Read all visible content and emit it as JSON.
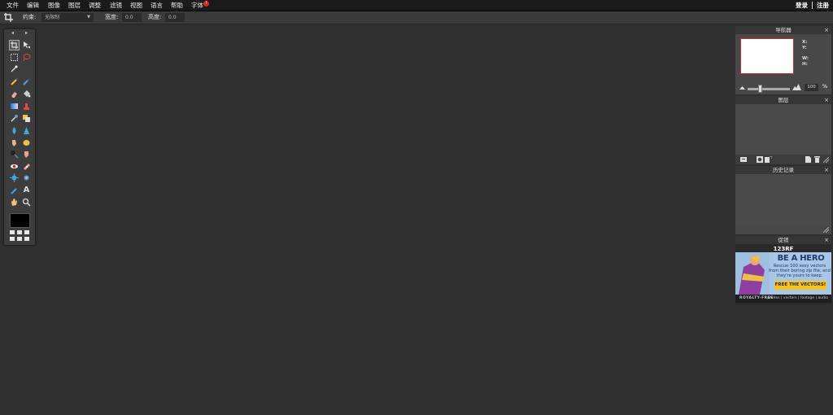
{
  "menu": [
    "文件",
    "编辑",
    "图像",
    "图层",
    "调整",
    "滤镜",
    "视图",
    "语言",
    "帮助",
    "字体"
  ],
  "font_badge": "!",
  "account": {
    "login": "登录",
    "register": "注册"
  },
  "options": {
    "constraint_label": "约束:",
    "constraint_value": "无限制",
    "width_label": "宽度:",
    "width_value": "0.0",
    "height_label": "高度:",
    "height_value": "0.0"
  },
  "toolbox": {
    "prev_arrow": "◂",
    "next_arrow": "▸",
    "text_tool": "A"
  },
  "colors": {
    "foreground": "#000000",
    "accent_red": "#e02424",
    "nav_border": "#c43030",
    "cta": "#f5c518"
  },
  "panels": {
    "navigator": {
      "title": "导航器",
      "close": "×",
      "x_label": "X:",
      "y_label": "Y:",
      "w_label": "W:",
      "h_label": "H:",
      "zoom_value": "100",
      "zoom_unit": "%"
    },
    "layers": {
      "title": "图层",
      "close": "×"
    },
    "history": {
      "title": "历史记录",
      "close": "×"
    },
    "promo": {
      "title": "促销",
      "close": "×"
    }
  },
  "ad": {
    "logo": "123RF",
    "headline": "BE A HERO",
    "body": "Rescue 100 sexy vectors from their boring zip file, and they're yours to keep.",
    "cta": "FREE THE VECTORS!",
    "footer_left": "ROYALTY-FREE",
    "footer_right": "photos | vectors | footage | audio"
  }
}
